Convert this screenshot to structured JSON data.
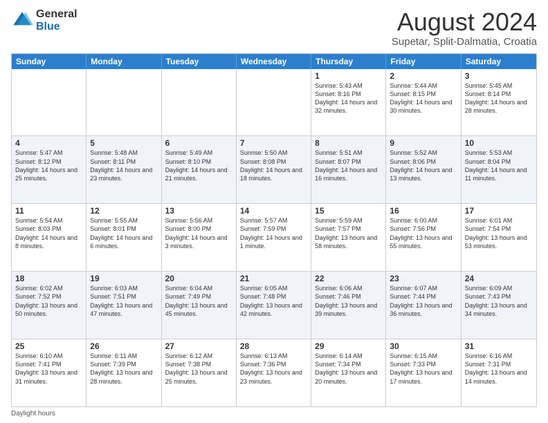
{
  "header": {
    "logo_general": "General",
    "logo_blue": "Blue",
    "main_title": "August 2024",
    "subtitle": "Supetar, Split-Dalmatia, Croatia"
  },
  "calendar": {
    "days_of_week": [
      "Sunday",
      "Monday",
      "Tuesday",
      "Wednesday",
      "Thursday",
      "Friday",
      "Saturday"
    ],
    "footer_note": "Daylight hours",
    "weeks": [
      {
        "alt": false,
        "cells": [
          {
            "day": "",
            "text": ""
          },
          {
            "day": "",
            "text": ""
          },
          {
            "day": "",
            "text": ""
          },
          {
            "day": "",
            "text": ""
          },
          {
            "day": "1",
            "text": "Sunrise: 5:43 AM\nSunset: 8:16 PM\nDaylight: 14 hours\nand 32 minutes."
          },
          {
            "day": "2",
            "text": "Sunrise: 5:44 AM\nSunset: 8:15 PM\nDaylight: 14 hours\nand 30 minutes."
          },
          {
            "day": "3",
            "text": "Sunrise: 5:45 AM\nSunset: 8:14 PM\nDaylight: 14 hours\nand 28 minutes."
          }
        ]
      },
      {
        "alt": true,
        "cells": [
          {
            "day": "4",
            "text": "Sunrise: 5:47 AM\nSunset: 8:12 PM\nDaylight: 14 hours\nand 25 minutes."
          },
          {
            "day": "5",
            "text": "Sunrise: 5:48 AM\nSunset: 8:11 PM\nDaylight: 14 hours\nand 23 minutes."
          },
          {
            "day": "6",
            "text": "Sunrise: 5:49 AM\nSunset: 8:10 PM\nDaylight: 14 hours\nand 21 minutes."
          },
          {
            "day": "7",
            "text": "Sunrise: 5:50 AM\nSunset: 8:08 PM\nDaylight: 14 hours\nand 18 minutes."
          },
          {
            "day": "8",
            "text": "Sunrise: 5:51 AM\nSunset: 8:07 PM\nDaylight: 14 hours\nand 16 minutes."
          },
          {
            "day": "9",
            "text": "Sunrise: 5:52 AM\nSunset: 8:06 PM\nDaylight: 14 hours\nand 13 minutes."
          },
          {
            "day": "10",
            "text": "Sunrise: 5:53 AM\nSunset: 8:04 PM\nDaylight: 14 hours\nand 11 minutes."
          }
        ]
      },
      {
        "alt": false,
        "cells": [
          {
            "day": "11",
            "text": "Sunrise: 5:54 AM\nSunset: 8:03 PM\nDaylight: 14 hours\nand 8 minutes."
          },
          {
            "day": "12",
            "text": "Sunrise: 5:55 AM\nSunset: 8:01 PM\nDaylight: 14 hours\nand 6 minutes."
          },
          {
            "day": "13",
            "text": "Sunrise: 5:56 AM\nSunset: 8:00 PM\nDaylight: 14 hours\nand 3 minutes."
          },
          {
            "day": "14",
            "text": "Sunrise: 5:57 AM\nSunset: 7:59 PM\nDaylight: 14 hours\nand 1 minute."
          },
          {
            "day": "15",
            "text": "Sunrise: 5:59 AM\nSunset: 7:57 PM\nDaylight: 13 hours\nand 58 minutes."
          },
          {
            "day": "16",
            "text": "Sunrise: 6:00 AM\nSunset: 7:56 PM\nDaylight: 13 hours\nand 55 minutes."
          },
          {
            "day": "17",
            "text": "Sunrise: 6:01 AM\nSunset: 7:54 PM\nDaylight: 13 hours\nand 53 minutes."
          }
        ]
      },
      {
        "alt": true,
        "cells": [
          {
            "day": "18",
            "text": "Sunrise: 6:02 AM\nSunset: 7:52 PM\nDaylight: 13 hours\nand 50 minutes."
          },
          {
            "day": "19",
            "text": "Sunrise: 6:03 AM\nSunset: 7:51 PM\nDaylight: 13 hours\nand 47 minutes."
          },
          {
            "day": "20",
            "text": "Sunrise: 6:04 AM\nSunset: 7:49 PM\nDaylight: 13 hours\nand 45 minutes."
          },
          {
            "day": "21",
            "text": "Sunrise: 6:05 AM\nSunset: 7:48 PM\nDaylight: 13 hours\nand 42 minutes."
          },
          {
            "day": "22",
            "text": "Sunrise: 6:06 AM\nSunset: 7:46 PM\nDaylight: 13 hours\nand 39 minutes."
          },
          {
            "day": "23",
            "text": "Sunrise: 6:07 AM\nSunset: 7:44 PM\nDaylight: 13 hours\nand 36 minutes."
          },
          {
            "day": "24",
            "text": "Sunrise: 6:09 AM\nSunset: 7:43 PM\nDaylight: 13 hours\nand 34 minutes."
          }
        ]
      },
      {
        "alt": false,
        "cells": [
          {
            "day": "25",
            "text": "Sunrise: 6:10 AM\nSunset: 7:41 PM\nDaylight: 13 hours\nand 31 minutes."
          },
          {
            "day": "26",
            "text": "Sunrise: 6:11 AM\nSunset: 7:39 PM\nDaylight: 13 hours\nand 28 minutes."
          },
          {
            "day": "27",
            "text": "Sunrise: 6:12 AM\nSunset: 7:38 PM\nDaylight: 13 hours\nand 25 minutes."
          },
          {
            "day": "28",
            "text": "Sunrise: 6:13 AM\nSunset: 7:36 PM\nDaylight: 13 hours\nand 23 minutes."
          },
          {
            "day": "29",
            "text": "Sunrise: 6:14 AM\nSunset: 7:34 PM\nDaylight: 13 hours\nand 20 minutes."
          },
          {
            "day": "30",
            "text": "Sunrise: 6:15 AM\nSunset: 7:33 PM\nDaylight: 13 hours\nand 17 minutes."
          },
          {
            "day": "31",
            "text": "Sunrise: 6:16 AM\nSunset: 7:31 PM\nDaylight: 13 hours\nand 14 minutes."
          }
        ]
      }
    ]
  }
}
